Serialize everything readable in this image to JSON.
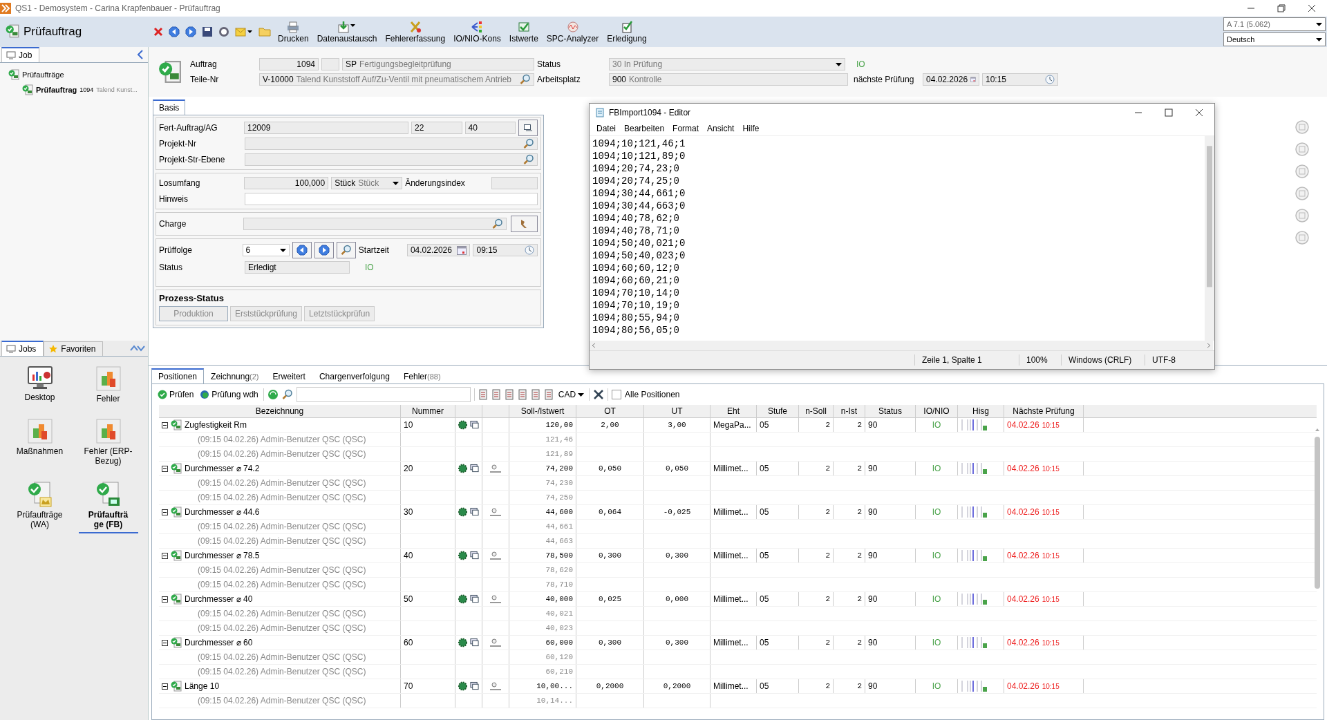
{
  "window": {
    "title": "QS1 - Demosystem - Carina Krapfenbauer - Prüfauftrag"
  },
  "toolbar": {
    "title": "Prüfauftrag",
    "buttons": [
      {
        "label": "Drucken",
        "kind": "print"
      },
      {
        "label": "Datenaustausch",
        "kind": "exchange"
      },
      {
        "label": "Fehlererfassung",
        "kind": "error"
      },
      {
        "label": "IO/NIO-Kons",
        "kind": "kons"
      },
      {
        "label": "Istwerte",
        "kind": "values"
      },
      {
        "label": "SPC-Analyzer",
        "kind": "spc"
      },
      {
        "label": "Erledigung",
        "kind": "done"
      }
    ],
    "version_select": "A 7.1 (5.062)",
    "language_select": "Deutsch"
  },
  "sidebar": {
    "tab": "Job",
    "tree": [
      {
        "label": "Prüfaufträge",
        "selected": false,
        "children": [
          {
            "label": "Prüfauftrag",
            "number": "1094",
            "detail": "Talend Kunst...",
            "selected": true
          }
        ]
      }
    ],
    "bottom_tabs": [
      {
        "label": "Jobs",
        "selected": true,
        "kind": "jobs"
      },
      {
        "label": "Favoriten",
        "selected": false,
        "kind": "star"
      }
    ],
    "tiles": [
      {
        "label": "Desktop",
        "kind": "desktop",
        "selected": false
      },
      {
        "label": "Fehler",
        "kind": "blocks",
        "selected": false
      },
      {
        "label": "Maßnahmen",
        "kind": "blocks",
        "selected": false
      },
      {
        "label": "Fehler (ERP-Bezug)",
        "kind": "blocks",
        "selected": false
      },
      {
        "label": "Prüfaufträge (WA)",
        "kind": "wa",
        "selected": false
      },
      {
        "label": "Prüfaufträge (FB)",
        "kind": "fb",
        "selected": true
      }
    ]
  },
  "header": {
    "auftrag_label": "Auftrag",
    "auftrag": "1094",
    "type_code": "SP",
    "type_text": "Fertigungsbegleitprüfung",
    "status_label": "Status",
    "status_code": "30",
    "status_text": "In Prüfung",
    "status_result": "IO",
    "teile_label": "Teile-Nr",
    "teile_code": "V-10000",
    "teile_text": "Talend Kunststoff Auf/Zu-Ventil mit pneumatischem Antrieb",
    "arbeitsplatz_label": "Arbeitsplatz",
    "arbeitsplatz_code": "900",
    "arbeitsplatz_text": "Kontrolle",
    "next_label": "nächste Prüfung",
    "next_date": "04.02.2026",
    "next_time": "10:15"
  },
  "basis": {
    "tab": "Basis",
    "fert_label": "Fert-Auftrag/AG",
    "fert": "12009",
    "fert_2": "22",
    "fert_3": "40",
    "projekt_label": "Projekt-Nr",
    "projekt_str_label": "Projekt-Str-Ebene",
    "losumfang_label": "Losumfang",
    "losumfang": "100,000",
    "unit_code": "Stück",
    "unit_text": "Stück",
    "aenderung_label": "Änderungsindex",
    "hinweis_label": "Hinweis",
    "charge_label": "Charge",
    "prueffolge_label": "Prüffolge",
    "prueffolge": "6",
    "startzeit_label": "Startzeit",
    "start_date": "04.02.2026",
    "start_time": "09:15",
    "status_label": "Status",
    "status": "Erledigt",
    "status_result": "IO",
    "prozess_title": "Prozess-Status",
    "prozess_buttons": [
      {
        "label": "Produktion",
        "selected": true
      },
      {
        "label": "Erststückprüfung",
        "selected": false
      },
      {
        "label": "Letztstückprüfun",
        "selected": false
      }
    ]
  },
  "editor": {
    "title": "FBImport1094 - Editor",
    "menu": [
      "Datei",
      "Bearbeiten",
      "Format",
      "Ansicht",
      "Hilfe"
    ],
    "lines": [
      "1094;10;121,46;1",
      "1094;10;121,89;0",
      "1094;20;74,23;0",
      "1094;20;74,25;0",
      "1094;30;44,661;0",
      "1094;30;44,663;0",
      "1094;40;78,62;0",
      "1094;40;78,71;0",
      "1094;50;40,021;0",
      "1094;50;40,023;0",
      "1094;60;60,12;0",
      "1094;60;60,21;0",
      "1094;70;10,14;0",
      "1094;70;10,19;0",
      "1094;80;55,94;0",
      "1094;80;56,05;0"
    ],
    "status": [
      "Zeile 1, Spalte 1",
      "100%",
      "Windows (CRLF)",
      "UTF-8"
    ]
  },
  "lower_tabs": [
    {
      "label": "Positionen",
      "selected": true
    },
    {
      "label": "Zeichnung",
      "count": "(2)",
      "selected": false
    },
    {
      "label": "Erweitert",
      "selected": false
    },
    {
      "label": "Chargenverfolgung",
      "selected": false
    },
    {
      "label": "Fehler",
      "count": "(88)",
      "selected": false
    }
  ],
  "table_toolbar": {
    "pruefen": "Prüfen",
    "pruefung_wdh": "Prüfung wdh",
    "cad": "CAD",
    "alle_positionen": "Alle Positionen",
    "alle_checked": false
  },
  "table": {
    "columns": [
      {
        "kind": "text",
        "label": "Bezeichnung"
      },
      {
        "kind": "text",
        "label": "Nummer"
      },
      {
        "kind": "icons"
      },
      {
        "kind": "icons"
      },
      {
        "kind": "text",
        "label": "Soll-/Istwert"
      },
      {
        "kind": "text",
        "label": "OT"
      },
      {
        "kind": "text",
        "label": "UT"
      },
      {
        "kind": "text",
        "label": "Eht"
      },
      {
        "kind": "text",
        "label": "Stufe"
      },
      {
        "kind": "text",
        "label": "n-Soll"
      },
      {
        "kind": "text",
        "label": "n-Ist"
      },
      {
        "kind": "text",
        "label": "Status"
      },
      {
        "kind": "text",
        "label": "IO/NIO"
      },
      {
        "kind": "text",
        "label": "Hisg"
      },
      {
        "kind": "text",
        "label": "Nächste Prüfung"
      }
    ],
    "rows": [
      {
        "name": "Zugfestigkeit Rm",
        "nummer": "10",
        "gauge": false,
        "soll": "120,00",
        "ot": "2,00",
        "ut": "3,00",
        "eht": "MegaPa...",
        "stufe": "05",
        "n_soll": "2",
        "n_ist": "2",
        "status": "90",
        "io": "IO",
        "next_date": "04.02.26",
        "next_time": "10:15",
        "expanded": true,
        "children": [
          {
            "label": "(09:15 04.02.26) Admin-Benutzer QSC (QSC)",
            "value": "121,46"
          },
          {
            "label": "(09:15 04.02.26) Admin-Benutzer QSC (QSC)",
            "value": "121,89"
          }
        ]
      },
      {
        "name": "Durchmesser ⌀ 74.2",
        "nummer": "20",
        "gauge": true,
        "soll": "74,200",
        "ot": "0,050",
        "ut": "0,050",
        "eht": "Millimet...",
        "stufe": "05",
        "n_soll": "2",
        "n_ist": "2",
        "status": "90",
        "io": "IO",
        "next_date": "04.02.26",
        "next_time": "10:15",
        "expanded": true,
        "children": [
          {
            "label": "(09:15 04.02.26) Admin-Benutzer QSC (QSC)",
            "value": "74,230"
          },
          {
            "label": "(09:15 04.02.26) Admin-Benutzer QSC (QSC)",
            "value": "74,250"
          }
        ]
      },
      {
        "name": "Durchmesser ⌀ 44.6",
        "nummer": "30",
        "gauge": true,
        "soll": "44,600",
        "ot": "0,064",
        "ut": "-0,025",
        "eht": "Millimet...",
        "stufe": "05",
        "n_soll": "2",
        "n_ist": "2",
        "status": "90",
        "io": "IO",
        "next_date": "04.02.26",
        "next_time": "10:15",
        "expanded": true,
        "children": [
          {
            "label": "(09:15 04.02.26) Admin-Benutzer QSC (QSC)",
            "value": "44,661"
          },
          {
            "label": "(09:15 04.02.26) Admin-Benutzer QSC (QSC)",
            "value": "44,663"
          }
        ]
      },
      {
        "name": "Durchmesser ⌀ 78.5",
        "nummer": "40",
        "gauge": true,
        "soll": "78,500",
        "ot": "0,300",
        "ut": "0,300",
        "eht": "Millimet...",
        "stufe": "05",
        "n_soll": "2",
        "n_ist": "2",
        "status": "90",
        "io": "IO",
        "next_date": "04.02.26",
        "next_time": "10:15",
        "expanded": true,
        "children": [
          {
            "label": "(09:15 04.02.26) Admin-Benutzer QSC (QSC)",
            "value": "78,620"
          },
          {
            "label": "(09:15 04.02.26) Admin-Benutzer QSC (QSC)",
            "value": "78,710"
          }
        ]
      },
      {
        "name": "Durchmesser ⌀ 40",
        "nummer": "50",
        "gauge": true,
        "soll": "40,000",
        "ot": "0,025",
        "ut": "0,000",
        "eht": "Millimet...",
        "stufe": "05",
        "n_soll": "2",
        "n_ist": "2",
        "status": "90",
        "io": "IO",
        "next_date": "04.02.26",
        "next_time": "10:15",
        "expanded": true,
        "children": [
          {
            "label": "(09:15 04.02.26) Admin-Benutzer QSC (QSC)",
            "value": "40,021"
          },
          {
            "label": "(09:15 04.02.26) Admin-Benutzer QSC (QSC)",
            "value": "40,023"
          }
        ]
      },
      {
        "name": "Durchmesser ⌀ 60",
        "nummer": "60",
        "gauge": true,
        "soll": "60,000",
        "ot": "0,300",
        "ut": "0,300",
        "eht": "Millimet...",
        "stufe": "05",
        "n_soll": "2",
        "n_ist": "2",
        "status": "90",
        "io": "IO",
        "next_date": "04.02.26",
        "next_time": "10:15",
        "expanded": true,
        "children": [
          {
            "label": "(09:15 04.02.26) Admin-Benutzer QSC (QSC)",
            "value": "60,120"
          },
          {
            "label": "(09:15 04.02.26) Admin-Benutzer QSC (QSC)",
            "value": "60,210"
          }
        ]
      },
      {
        "name": "Länge 10",
        "nummer": "70",
        "gauge": true,
        "soll": "10,00...",
        "ot": "0,2000",
        "ut": "0,2000",
        "eht": "Millimet...",
        "stufe": "05",
        "n_soll": "2",
        "n_ist": "2",
        "status": "90",
        "io": "IO",
        "next_date": "04.02.26",
        "next_time": "10:15",
        "expanded": true,
        "children": [
          {
            "label": "(09:15 04.02.26) Admin-Benutzer QSC (QSC)",
            "value": "10,14..."
          }
        ]
      }
    ]
  }
}
